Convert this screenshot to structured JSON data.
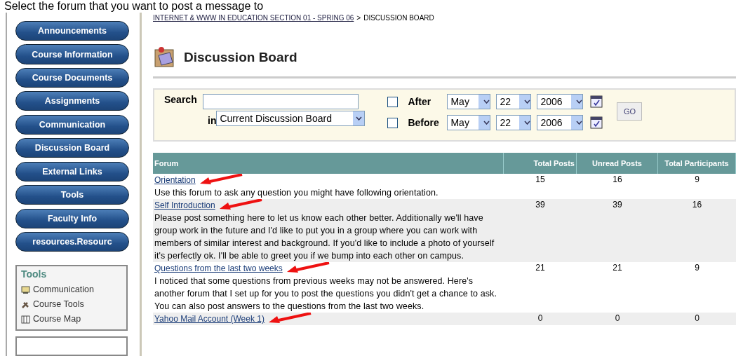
{
  "caption": "Select the forum that you want to post a message to",
  "sidebar": {
    "buttons": [
      "Announcements",
      "Course Information",
      "Course Documents",
      "Assignments",
      "Communication",
      "Discussion Board",
      "External Links",
      "Tools",
      "Faculty Info",
      "resources.Resourc"
    ],
    "tools_box": {
      "title": "Tools",
      "items": [
        {
          "label": "Communication",
          "kind": "monitor"
        },
        {
          "label": "Course Tools",
          "kind": "tools"
        },
        {
          "label": "Course Map",
          "kind": "map"
        }
      ]
    }
  },
  "breadcrumb": {
    "link": "INTERNET & WWW IN EDUCATION SECTION 01 - SPRING 06",
    "separator": ">",
    "current": "DISCUSSION BOARD"
  },
  "page_title": "Discussion Board",
  "search": {
    "label": "Search",
    "in_label": "in",
    "scope": "Current Discussion Board",
    "filters": [
      {
        "label": "After",
        "checked": false,
        "month": "May",
        "day": "22",
        "year": "2006"
      },
      {
        "label": "Before",
        "checked": false,
        "month": "May",
        "day": "22",
        "year": "2006"
      }
    ],
    "go_button": "GO"
  },
  "table": {
    "columns": [
      "Forum",
      "Total Posts",
      "Unread Posts",
      "Total Participants"
    ],
    "rows": [
      {
        "title": "Orientation",
        "description": "Use this forum to ask any question you might have following orientation.",
        "pointed_at": true,
        "total_posts": "15",
        "unread_posts": "16",
        "total_participants": "9"
      },
      {
        "title": "Self Introduction",
        "description": "Please post something here to let us know each other better. Additionally we'll have group work in the future and I'd like to put you in a group where you can work with members of similar interest and background. If you'd like to include a photo of yourself it's perfectly ok. I'll be able to greet you if we bump into each other on campus.",
        "pointed_at": true,
        "total_posts": "39",
        "unread_posts": "39",
        "total_participants": "16"
      },
      {
        "title": "Questions from the last two weeks",
        "description": "I noticed that some questions from previous weeks may not be answered. Here's another forum that I set up for you to post the questions you didn't get a chance to ask. You can also post answers to the questions from the last two weeks.",
        "pointed_at": true,
        "total_posts": "21",
        "unread_posts": "21",
        "total_participants": "9"
      },
      {
        "title": "Yahoo Mail Account (Week 1)",
        "pointed_at": true,
        "total_posts": "0",
        "unread_posts": "0",
        "total_participants": "0"
      }
    ]
  }
}
